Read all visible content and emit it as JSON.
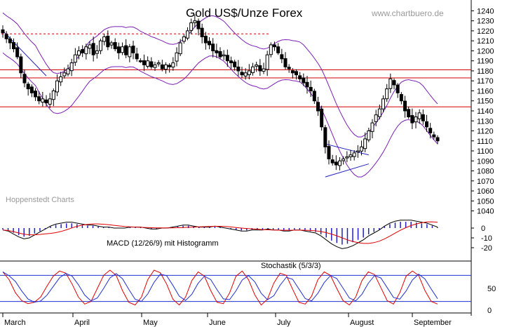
{
  "chart_data": [
    {
      "type": "candlestick",
      "title": "Gold US$/Unze Forex",
      "watermark": "www.chartbuero.de",
      "source": "Hoppenstedt Charts",
      "x_labels": [
        "March",
        "April",
        "May",
        "June",
        "July",
        "August",
        "September"
      ],
      "ylim": [
        1032,
        1248
      ],
      "y_ticks": [
        1040,
        1050,
        1060,
        1070,
        1080,
        1090,
        1100,
        1110,
        1120,
        1130,
        1140,
        1150,
        1160,
        1170,
        1180,
        1190,
        1200,
        1210,
        1220,
        1230,
        1240
      ],
      "horizontal_levels": [
        1181,
        1173,
        1144
      ],
      "dashed_level": 1217,
      "close": [
        1218,
        1212,
        1208,
        1202,
        1194,
        1178,
        1168,
        1162,
        1158,
        1154,
        1150,
        1152,
        1148,
        1152,
        1160,
        1170,
        1174,
        1178,
        1182,
        1188,
        1196,
        1200,
        1198,
        1204,
        1206,
        1196,
        1200,
        1210,
        1214,
        1204,
        1208,
        1202,
        1198,
        1204,
        1196,
        1204,
        1198,
        1192,
        1190,
        1186,
        1190,
        1184,
        1186,
        1188,
        1182,
        1186,
        1184,
        1188,
        1198,
        1208,
        1214,
        1220,
        1228,
        1230,
        1222,
        1214,
        1208,
        1206,
        1200,
        1198,
        1194,
        1196,
        1190,
        1188,
        1184,
        1180,
        1176,
        1178,
        1180,
        1184,
        1186,
        1180,
        1182,
        1196,
        1206,
        1204,
        1198,
        1192,
        1184,
        1182,
        1178,
        1176,
        1172,
        1168,
        1164,
        1160,
        1150,
        1140,
        1124,
        1104,
        1092,
        1088,
        1086,
        1090,
        1092,
        1094,
        1096,
        1098,
        1100,
        1104,
        1112,
        1120,
        1128,
        1136,
        1142,
        1152,
        1162,
        1172,
        1166,
        1158,
        1150,
        1140,
        1134,
        1128,
        1134,
        1138,
        1130,
        1124,
        1118,
        1114,
        1110
      ],
      "macd": [
        -2,
        -3,
        -6,
        -9,
        -11,
        -10,
        -7,
        -4,
        -1,
        2,
        4,
        5,
        6,
        6,
        5,
        4,
        3,
        3,
        2,
        1,
        1,
        0,
        0,
        0,
        1,
        1,
        1,
        0,
        -1,
        -1,
        0,
        0,
        1,
        2,
        3,
        3,
        2,
        1,
        1,
        1,
        2,
        1,
        0,
        -1,
        -2,
        -3,
        -3,
        -2,
        -2,
        -2,
        -1,
        -2,
        -2,
        -3,
        -3,
        -2,
        -2,
        -3,
        -4,
        -5,
        -8,
        -12,
        -16,
        -19,
        -21,
        -20,
        -18,
        -15,
        -12,
        -8,
        -5,
        -2,
        2,
        5,
        7,
        8,
        8,
        8,
        7,
        6,
        5,
        3,
        1
      ],
      "macd_label": "MACD (12/26/9) mit Histogramm",
      "macd_ticks": [
        0,
        -10,
        -20
      ],
      "stoch_label": "Stochastik (5/3/3)",
      "stoch_ticks": [
        50,
        0
      ],
      "stoch_bands": [
        80,
        20
      ],
      "stoch_k": [
        88,
        70,
        40,
        22,
        15,
        18,
        30,
        55,
        78,
        90,
        85,
        60,
        30,
        14,
        20,
        50,
        80,
        92,
        80,
        45,
        18,
        12,
        30,
        70,
        92,
        86,
        60,
        25,
        12,
        30,
        68,
        88,
        78,
        45,
        18,
        15,
        40,
        78,
        90,
        70,
        35,
        12,
        25,
        62,
        85,
        80,
        48,
        18,
        14,
        32,
        70,
        88,
        80,
        50,
        22,
        12,
        30,
        68,
        88,
        82,
        52,
        22,
        14,
        40,
        78,
        90,
        80,
        45,
        20,
        14
      ],
      "colors": {
        "candle": "#000000",
        "band": "#7a1fb5",
        "level": "#d00000",
        "trend": "#2020c0",
        "signal_red": "#e00000",
        "stoch_blue": "#2030d0",
        "grid": "#000000"
      }
    }
  ]
}
